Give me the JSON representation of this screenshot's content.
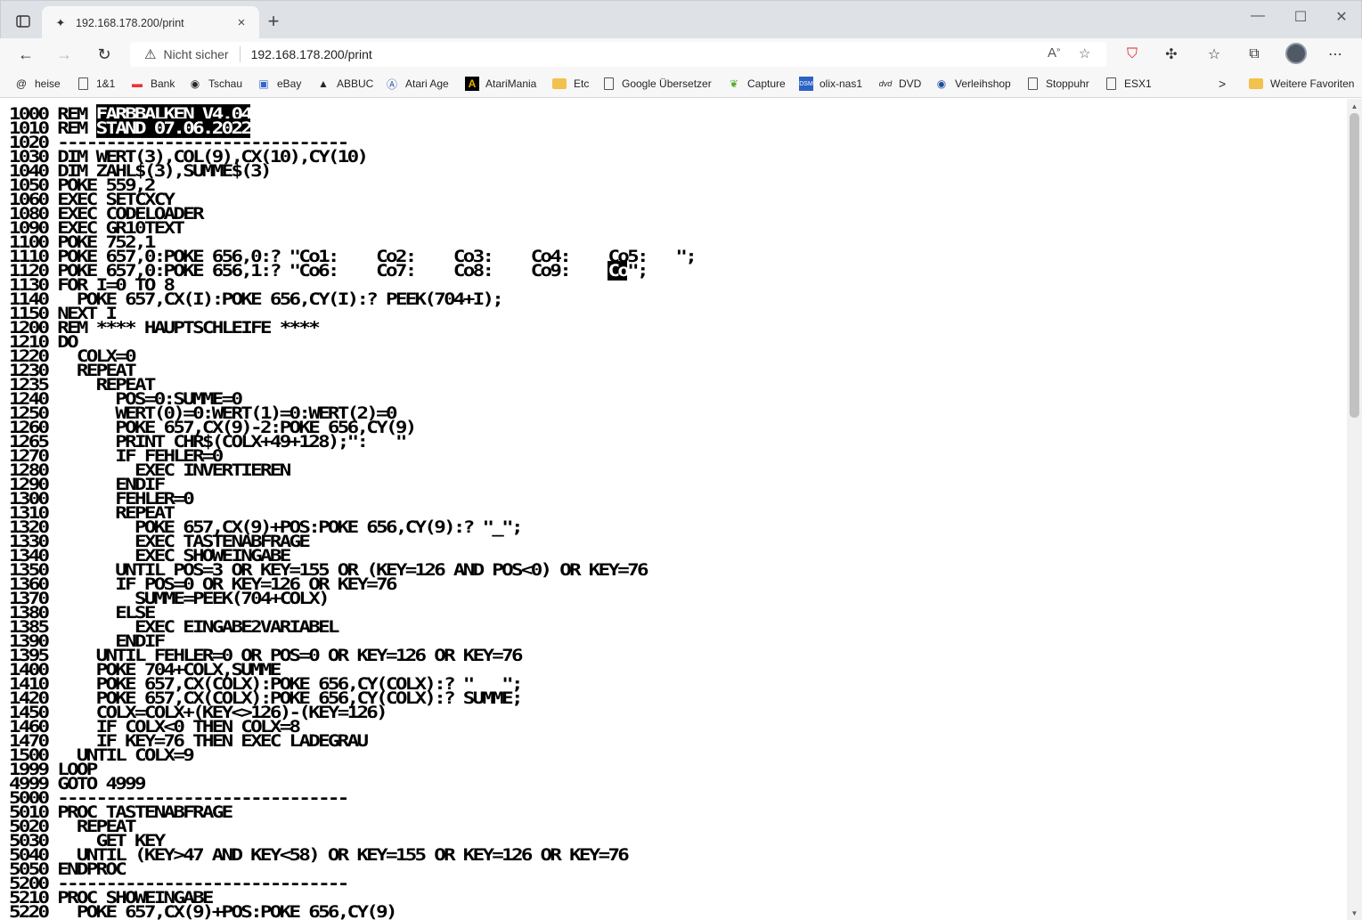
{
  "browser": {
    "tab_title": "192.168.178.200/print",
    "tab_close": "×",
    "new_tab": "+",
    "window_controls": {
      "minimize": "—",
      "maximize": "☐",
      "close": "✕"
    },
    "security_label": "Nicht sicher",
    "url": "192.168.178.200/print",
    "favorites": [
      {
        "label": "heise",
        "icon": "heise-icon"
      },
      {
        "label": "1&1",
        "icon": "page-icon"
      },
      {
        "label": "Bank",
        "icon": "bank-icon"
      },
      {
        "label": "Tschau",
        "icon": "tschau-icon"
      },
      {
        "label": "eBay",
        "icon": "ebay-icon"
      },
      {
        "label": "ABBUC",
        "icon": "abbuc-icon"
      },
      {
        "label": "Atari Age",
        "icon": "atariage-icon"
      },
      {
        "label": "AtariMania",
        "icon": "atarimania-icon"
      },
      {
        "label": "Etc",
        "icon": "folder-icon"
      },
      {
        "label": "Google Übersetzer",
        "icon": "page-icon"
      },
      {
        "label": "Capture",
        "icon": "capture-icon"
      },
      {
        "label": "olix-nas1",
        "icon": "nas-icon"
      },
      {
        "label": "DVD",
        "icon": "dvd-icon"
      },
      {
        "label": "Verleihshop",
        "icon": "verleihshop-icon"
      },
      {
        "label": "Stoppuhr",
        "icon": "page-icon"
      },
      {
        "label": "ESX1",
        "icon": "page-icon"
      }
    ],
    "more_favorites_chevron": ">",
    "other_favorites": "Weitere Favoriten"
  },
  "listing": {
    "lines": [
      "1000 REM ",
      "1010 REM ",
      "1020 ------------------------------",
      "1030 DIM WERT(3),COL(9),CX(10),CY(10)",
      "1040 DIM ZAHL$(3),SUMME$(3)",
      "1050 POKE 559,2",
      "1060 EXEC SETCXCY",
      "1080 EXEC CODELOADER",
      "1090 EXEC GR10TEXT",
      "1100 POKE 752,1",
      "1110 POKE 657,0:POKE 656,0:? \"Co1:    Co2:    Co3:    Co4:    Co5:   \";",
      "1120 POKE 657,0:POKE 656,1:? \"Co6:    Co7:    Co8:    Co9:    ",
      "1130 FOR I=0 TO 8",
      "1140   POKE 657,CX(I):POKE 656,CY(I):? PEEK(704+I);",
      "1150 NEXT I",
      "1200 REM **** HAUPTSCHLEIFE ****",
      "1210 DO",
      "1220   COLX=0",
      "1230   REPEAT",
      "1235     REPEAT",
      "1240       POS=0:SUMME=0",
      "1250       WERT(0)=0:WERT(1)=0:WERT(2)=0",
      "1260       POKE 657,CX(9)-2:POKE 656,CY(9)",
      "1265       PRINT CHR$(COLX+49+128);\":   \"",
      "1270       IF FEHLER=0",
      "1280         EXEC INVERTIEREN",
      "1290       ENDIF",
      "1300       FEHLER=0",
      "1310       REPEAT",
      "1320         POKE 657,CX(9)+POS:POKE 656,CY(9):? \"_\";",
      "1330         EXEC TASTENABFRAGE",
      "1340         EXEC SHOWEINGABE",
      "1350       UNTIL POS=3 OR KEY=155 OR (KEY=126 AND POS<0) OR KEY=76",
      "1360       IF POS=0 OR KEY=126 OR KEY=76",
      "1370         SUMME=PEEK(704+COLX)",
      "1380       ELSE",
      "1385         EXEC EINGABE2VARIABEL",
      "1390       ENDIF",
      "1395     UNTIL FEHLER=0 OR POS=0 OR KEY=126 OR KEY=76",
      "1400     POKE 704+COLX,SUMME",
      "1410     POKE 657,CX(COLX):POKE 656,CY(COLX):? \"   \";",
      "1420     POKE 657,CX(COLX):POKE 656,CY(COLX):? SUMME;",
      "1450     COLX=COLX+(KEY<>126)-(KEY=126)",
      "1460     IF COLX<0 THEN COLX=8",
      "1470     IF KEY=76 THEN EXEC LADEGRAU",
      "1500   UNTIL COLX=9",
      "1999 LOOP",
      "4999 GOTO 4999",
      "5000 ------------------------------",
      "5010 PROC TASTENABFRAGE",
      "5020   REPEAT",
      "5030     GET KEY",
      "5040   UNTIL (KEY>47 AND KEY<58) OR KEY=155 OR KEY=126 OR KEY=76",
      "5050 ENDPROC",
      "5200 ------------------------------",
      "5210 PROC SHOWEINGABE",
      "5220   POKE 657,CX(9)+POS:POKE 656,CY(9)"
    ],
    "inverse_1000": "FARBBALKEN V4.04",
    "inverse_1010": "STAND 07.06.2022",
    "inverse_1120": "Co",
    "tail_1120": "\";"
  }
}
